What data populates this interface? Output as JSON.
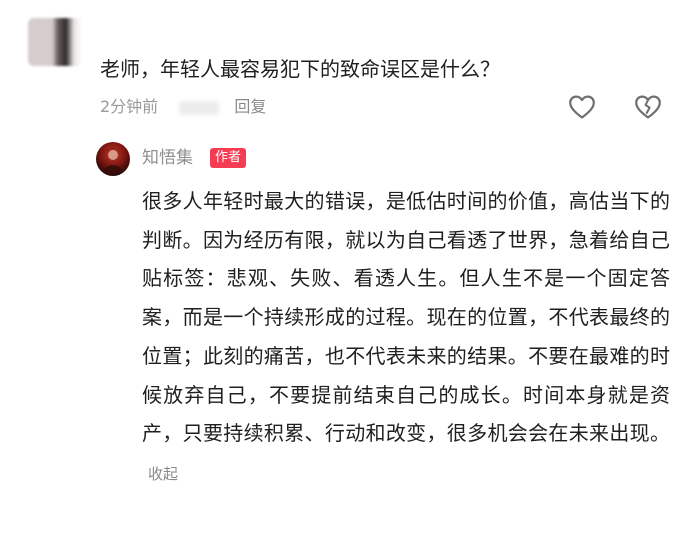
{
  "comment": {
    "question": "老师，年轻人最容易犯下的致命误区是什么？",
    "time": "2分钟前",
    "reply_label": "回复",
    "icons": {
      "like": "heart-icon",
      "dislike": "broken-heart-icon"
    }
  },
  "author_reply": {
    "author_name": "知悟集",
    "badge": "作者",
    "badge_color": "#f53c52",
    "text": "很多人年轻时最大的错误，是低估时间的价值，高估当下的判断。因为经历有限，就以为自己看透了世界，急着给自己贴标签：悲观、失败、看透人生。但人生不是一个固定答案，而是一个持续形成的过程。现在的位置，不代表最终的位置；此刻的痛苦，也不代表未来的结果。不要在最难的时候放弃自己，不要提前结束自己的成长。时间本身就是资产，只要持续积累、行动和改变，很多机会会在未来出现。",
    "collapse_label": "收起"
  }
}
